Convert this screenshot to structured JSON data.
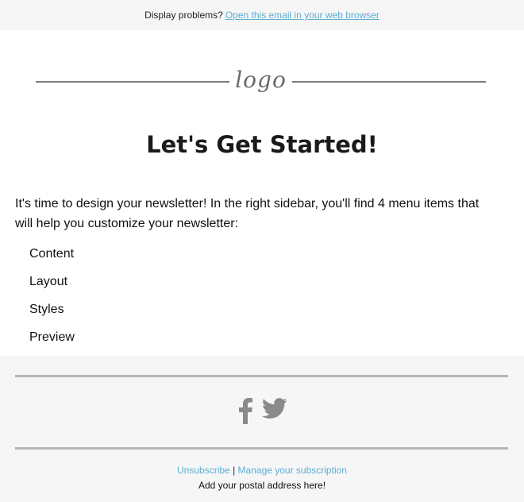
{
  "topbar": {
    "prompt": "Display problems?",
    "link": "Open this email in your web browser"
  },
  "header": {
    "logo_text": "logo"
  },
  "main": {
    "title": "Let's Get Started!",
    "intro": "It's time to design your newsletter! In the right sidebar, you'll find 4 menu items that will help you customize your newsletter:",
    "menu_items": [
      "Content",
      "Layout",
      "Styles",
      "Preview"
    ]
  },
  "footer": {
    "social_icons": [
      "facebook-icon",
      "twitter-icon"
    ],
    "unsubscribe": "Unsubscribe",
    "separator": "|",
    "manage": "Manage your subscription",
    "postal": "Add your postal address here!"
  },
  "colors": {
    "link": "#5aaed4",
    "divider": "#b5b5b5",
    "icon": "#8a8a8a",
    "background": "#f6f6f6"
  }
}
